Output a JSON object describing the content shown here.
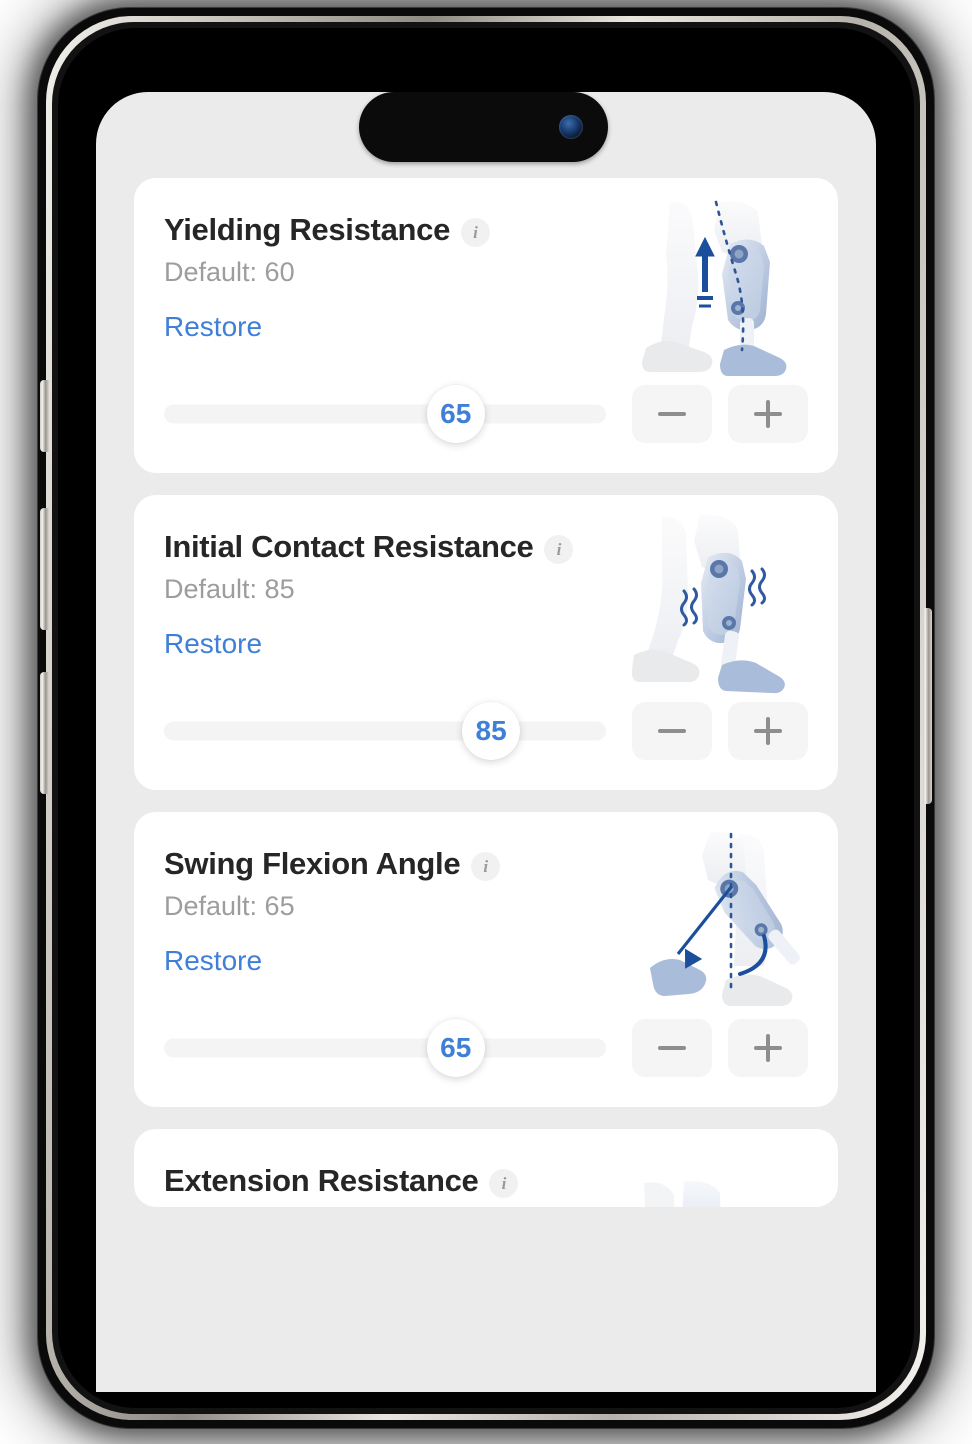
{
  "device": {
    "dynamic_island": "dynamic-island",
    "front_camera": "front-camera",
    "buttons": [
      "action-button",
      "volume-up-button",
      "volume-down-button",
      "power-button"
    ]
  },
  "theme": {
    "accent_blue": "#3f7fd6",
    "screen_background": "#ebebeb",
    "card_background": "#ffffff",
    "title_color": "#262626",
    "muted_text": "#9d9d9d",
    "track_color": "#f4f4f4",
    "step_button_background": "#f5f5f5",
    "step_glyph_color": "#8e8e8e",
    "illustration_blue": "#a8bcd9",
    "illustration_arrow": "#1b4f9c"
  },
  "slider": {
    "min": 0,
    "max": 100,
    "decrement_label": "minus",
    "increment_label": "plus"
  },
  "cards": [
    {
      "title": "Yielding Resistance",
      "info_label": "i",
      "default_label": "Default: 60",
      "default_value": 60,
      "restore_label": "Restore",
      "value": 65,
      "thumb_percent": 66,
      "illustration": "prosthetic-leg-yielding-up-arrow"
    },
    {
      "title": "Initial Contact Resistance",
      "info_label": "i",
      "default_label": "Default: 85",
      "default_value": 85,
      "restore_label": "Restore",
      "value": 85,
      "thumb_percent": 74,
      "illustration": "prosthetic-leg-initial-contact-vibration"
    },
    {
      "title": "Swing Flexion Angle",
      "info_label": "i",
      "default_label": "Default: 65",
      "default_value": 65,
      "restore_label": "Restore",
      "value": 65,
      "thumb_percent": 66,
      "illustration": "prosthetic-leg-swing-flexion-arc"
    },
    {
      "title": "Extension Resistance",
      "info_label": "i",
      "default_label": "",
      "default_value": null,
      "restore_label": "",
      "value": null,
      "thumb_percent": null,
      "illustration": "prosthetic-leg-extension-partial"
    }
  ]
}
